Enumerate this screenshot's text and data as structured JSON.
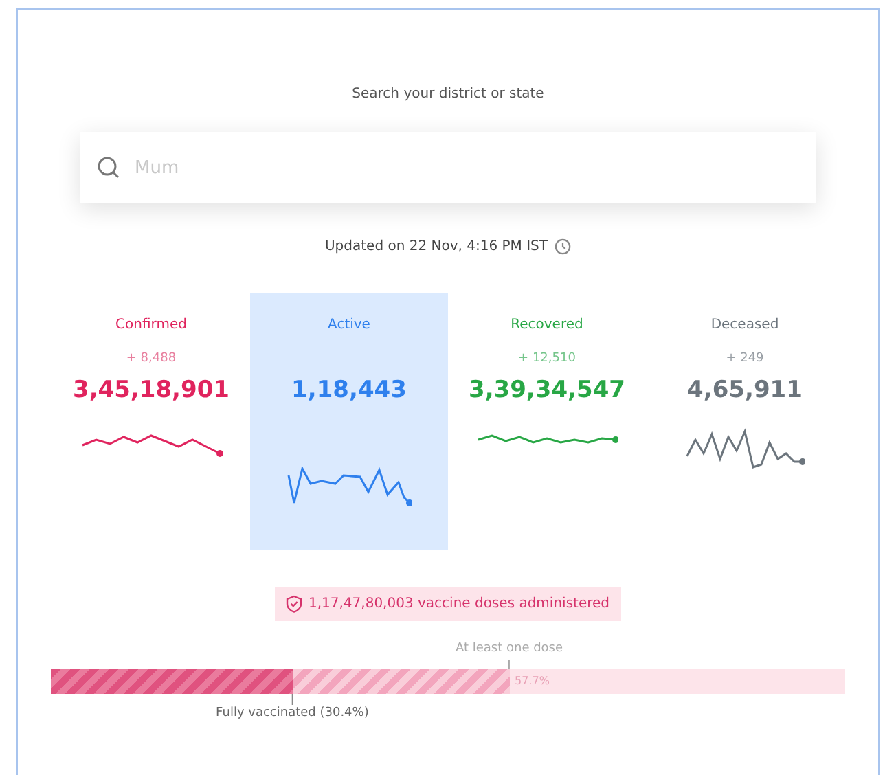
{
  "search": {
    "label": "Search your district or state",
    "placeholder": "Mum"
  },
  "updated": "Updated on 22 Nov, 4:16 PM IST",
  "stats": [
    {
      "kind": "confirmed",
      "label": "Confirmed",
      "delta": "+ 8,488",
      "value": "3,45,18,901",
      "selected": false
    },
    {
      "kind": "active",
      "label": "Active",
      "value": "1,18,443",
      "selected": true
    },
    {
      "kind": "recovered",
      "label": "Recovered",
      "delta": "+ 12,510",
      "value": "3,39,34,547",
      "selected": false
    },
    {
      "kind": "deceased",
      "label": "Deceased",
      "delta": "+ 249",
      "value": "4,65,911",
      "selected": false
    }
  ],
  "vaccination": {
    "doses": "1,17,47,80,003 vaccine doses administered",
    "one_dose": {
      "label": "At least one dose",
      "reading": "57.7%",
      "level": 0.577
    },
    "fully": {
      "label": "Fully vaccinated (30.4%)",
      "level": 0.304
    }
  }
}
